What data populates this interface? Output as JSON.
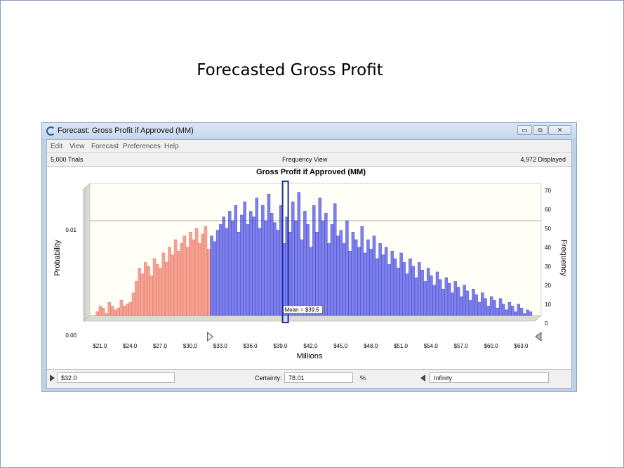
{
  "slide": {
    "title": "Forecasted Gross Profit"
  },
  "window": {
    "title": "Forecast: Gross Profit if Approved (MM)",
    "controls": {
      "minimize": "▭",
      "restore": "⧉",
      "close": "✕"
    }
  },
  "menu": [
    "Edit",
    "View",
    "Forecast",
    "Preferences",
    "Help"
  ],
  "info": {
    "trials": "5,000 Trials",
    "view": "Frequency View",
    "displayed": "4,972 Displayed"
  },
  "bottom": {
    "lower_value": "$32.0",
    "certainty_label": "Certainty:",
    "certainty_value": "78.01",
    "certainty_unit": "%",
    "upper_value": "Infinity"
  },
  "colors": {
    "left_tail": "#f4806e",
    "certainty": "#4a4ee8",
    "mean_line": "#1c2ca8",
    "window_frame": "#bdd2ea"
  },
  "chart_data": {
    "type": "bar",
    "title": "Gross Profit if Approved (MM)",
    "xlabel": "Millions",
    "ylabel": "Probability",
    "y2label": "Frequency",
    "x_ticks": [
      "$21.0",
      "$24.0",
      "$27.0",
      "$30.0",
      "$33.0",
      "$36.0",
      "$39.0",
      "$42.0",
      "$45.0",
      "$48.0",
      "$51.0",
      "$54.0",
      "$57.0",
      "$60.0",
      "$63.0"
    ],
    "xlim": [
      20,
      65
    ],
    "y_ticks": [
      "0.00",
      "0.01"
    ],
    "y2_ticks": [
      "0",
      "10",
      "20",
      "30",
      "40",
      "50",
      "60",
      "70"
    ],
    "y2lim": [
      0,
      70
    ],
    "gridline_frequency": 50,
    "lower_bound": 32.0,
    "mean": 39.5,
    "mean_label": "Mean = $39.5",
    "bin_width": 0.3,
    "x_start": 20.6,
    "frequencies": [
      2,
      5,
      4,
      1,
      7,
      5,
      3,
      4,
      8,
      5,
      6,
      7,
      12,
      18,
      25,
      22,
      28,
      26,
      21,
      30,
      27,
      25,
      33,
      28,
      36,
      32,
      40,
      34,
      38,
      42,
      36,
      44,
      40,
      46,
      38,
      43,
      47,
      35,
      42,
      39,
      45,
      48,
      52,
      46,
      55,
      50,
      58,
      44,
      53,
      60,
      48,
      55,
      52,
      62,
      46,
      58,
      50,
      64,
      54,
      49,
      45,
      58,
      38,
      52,
      44,
      60,
      50,
      65,
      40,
      55,
      48,
      36,
      58,
      44,
      62,
      50,
      54,
      38,
      48,
      59,
      42,
      45,
      38,
      50,
      34,
      44,
      40,
      36,
      47,
      33,
      40,
      35,
      42,
      30,
      38,
      32,
      36,
      27,
      34,
      30,
      25,
      33,
      28,
      22,
      30,
      26,
      20,
      28,
      24,
      18,
      25,
      21,
      16,
      23,
      19,
      14,
      20,
      17,
      12,
      18,
      15,
      10,
      16,
      13,
      8,
      14,
      11,
      7,
      12,
      9,
      5,
      10,
      8,
      4,
      9,
      6,
      3,
      7,
      5,
      2,
      6,
      4,
      1,
      3,
      2
    ]
  }
}
